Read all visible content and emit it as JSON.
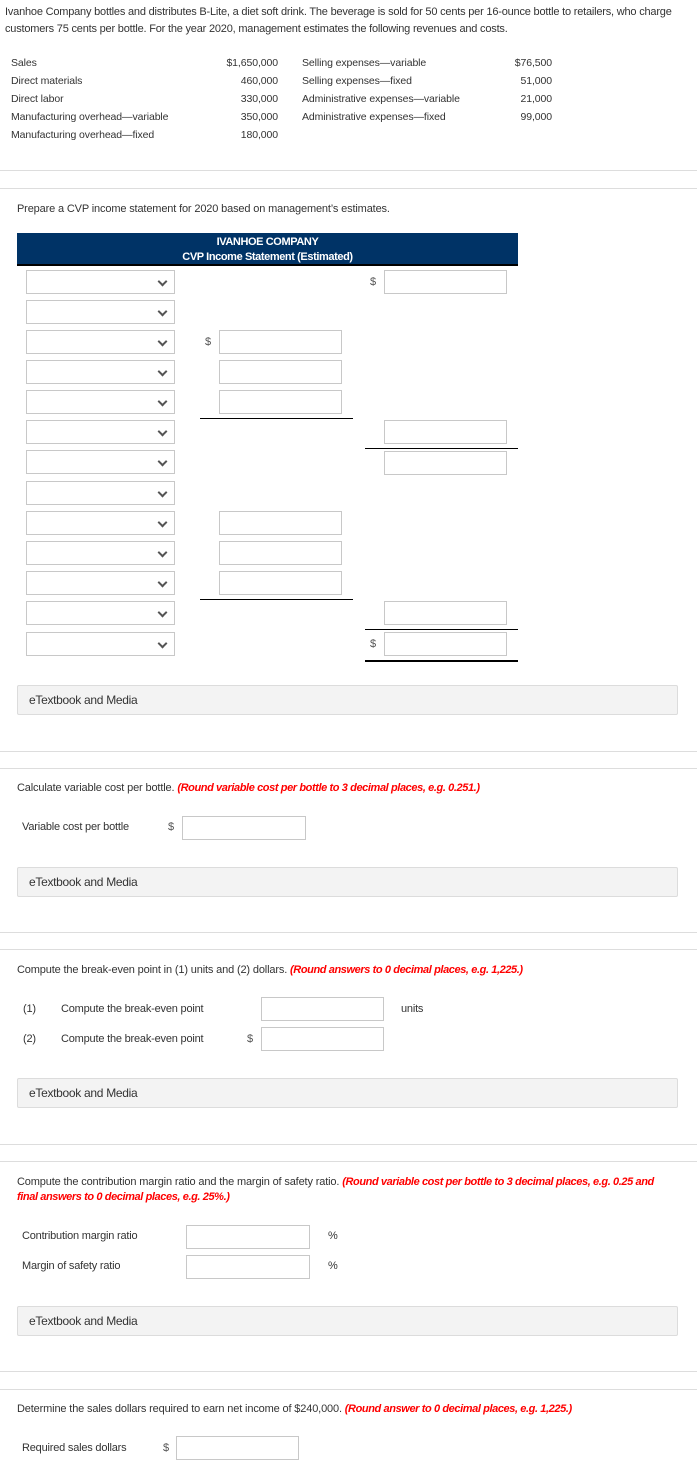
{
  "intro": "Ivanhoe Company bottles and distributes B-Lite, a diet soft drink. The beverage is sold for 50 cents per 16-ounce bottle to retailers, who charge customers 75 cents per bottle. For the year 2020, management estimates the following revenues and costs.",
  "given_left": [
    {
      "label": "Sales",
      "value": "$1,650,000"
    },
    {
      "label": "Direct materials",
      "value": "460,000"
    },
    {
      "label": "Direct labor",
      "value": "330,000"
    },
    {
      "label": "Manufacturing overhead—variable",
      "value": "350,000"
    },
    {
      "label": "Manufacturing overhead—fixed",
      "value": "180,000"
    }
  ],
  "given_right": [
    {
      "label": "Selling expenses—variable",
      "value": "$76,500"
    },
    {
      "label": "Selling expenses—fixed",
      "value": "51,000"
    },
    {
      "label": "Administrative expenses—variable",
      "value": "21,000"
    },
    {
      "label": "Administrative expenses—fixed",
      "value": "99,000"
    }
  ],
  "part1": {
    "question": "Prepare a CVP income statement for 2020 based on management’s estimates.",
    "statement_company": "IVANHOE COMPANY",
    "statement_title": "CVP Income Statement (Estimated)",
    "currency_symbol": "$",
    "select_value": "",
    "input_value": ""
  },
  "etextbook_label": "eTextbook and Media",
  "part2": {
    "question": "Calculate variable cost per bottle.",
    "instruction": "(Round variable cost per bottle to 3 decimal places, e.g. 0.251.)",
    "field_label": "Variable cost per bottle",
    "currency_symbol": "$",
    "value": ""
  },
  "part3": {
    "question": "Compute the break-even point in (1) units and (2) dollars.",
    "instruction": "(Round answers to 0 decimal places, e.g. 1,225.)",
    "rows": [
      {
        "num": "(1)",
        "label": "Compute the break-even point",
        "prefix": "",
        "suffix": "units",
        "value": ""
      },
      {
        "num": "(2)",
        "label": "Compute the break-even point",
        "prefix": "$",
        "suffix": "",
        "value": ""
      }
    ]
  },
  "part4": {
    "question": "Compute the contribution margin ratio and the margin of safety ratio.",
    "instruction": "(Round variable cost per bottle to 3 decimal places, e.g. 0.25 and final answers to 0 decimal places, e.g. 25%.)",
    "rows": [
      {
        "label": "Contribution margin ratio",
        "suffix": "%",
        "value": ""
      },
      {
        "label": "Margin of safety ratio",
        "suffix": "%",
        "value": ""
      }
    ]
  },
  "part5": {
    "question": "Determine the sales dollars required to earn net income of $240,000.",
    "instruction": "(Round answer to 0 decimal places, e.g. 1,225.)",
    "field_label": "Required sales dollars",
    "currency_symbol": "$",
    "value": ""
  }
}
